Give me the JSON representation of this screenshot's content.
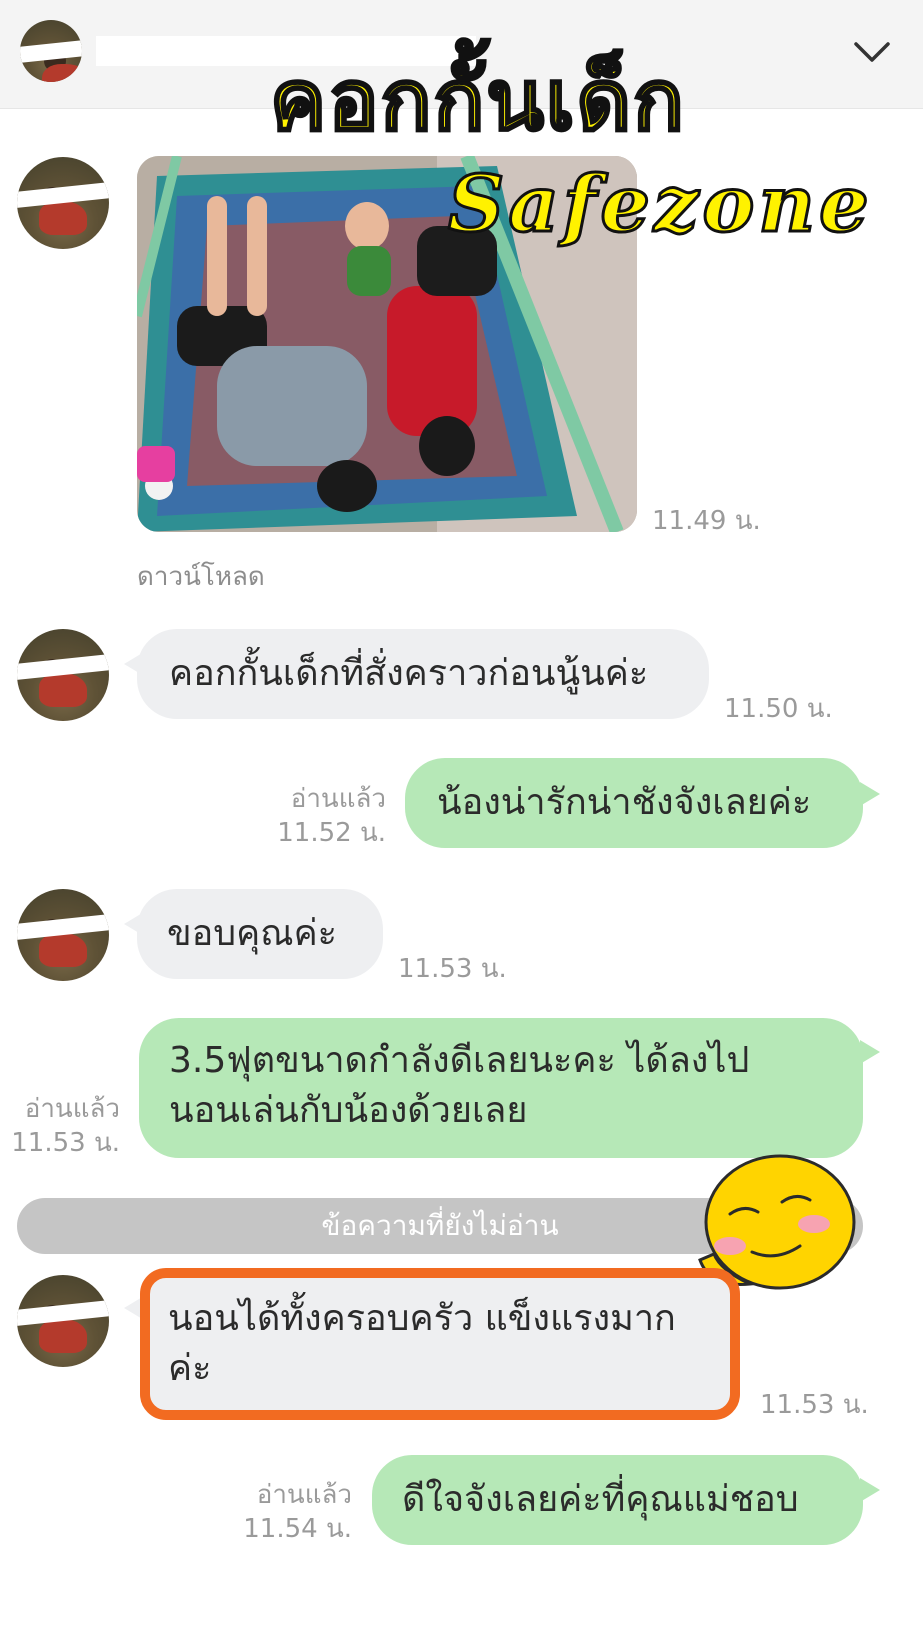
{
  "overlay": {
    "title": "คอกกั้นเด็ก",
    "subtitle": "Safezone"
  },
  "header": {
    "collapse_icon": "chevron-down-icon"
  },
  "messages": {
    "m1": {
      "time": "11.49 น.",
      "download": "ดาวน์โหลด"
    },
    "m2": {
      "text": "คอกกั้นเด็กที่สั่งคราวก่อนนู้นค่ะ",
      "time": "11.50 น."
    },
    "m3": {
      "text": "น้องน่ารักน่าชังจังเลยค่ะ",
      "read": "อ่านแล้ว",
      "time": "11.52 น."
    },
    "m4": {
      "text": "ขอบคุณค่ะ",
      "time": "11.53 น."
    },
    "m5": {
      "line1": "3.5ฟุตขนาดกำลังดีเลยนะคะ ได้ลงไป",
      "line2": "นอนเล่นกับน้องด้วยเลย",
      "read": "อ่านแล้ว",
      "time": "11.53 น."
    },
    "unread_divider": "ข้อความที่ยังไม่อ่าน",
    "m6": {
      "line1": "นอนได้ทั้งครอบครัว แข็งแรงมาก",
      "line2": "ค่ะ",
      "time": "11.53 น."
    },
    "m7": {
      "text": "ดีใจจังเลยค่ะที่คุณแม่ชอบ",
      "read": "อ่านแล้ว",
      "time": "11.54 น."
    }
  },
  "colors": {
    "incoming_bubble": "#eeeff1",
    "outgoing_bubble": "#b6e8b7",
    "highlight_border": "#f26b21",
    "overlay_text": "#fff200"
  }
}
